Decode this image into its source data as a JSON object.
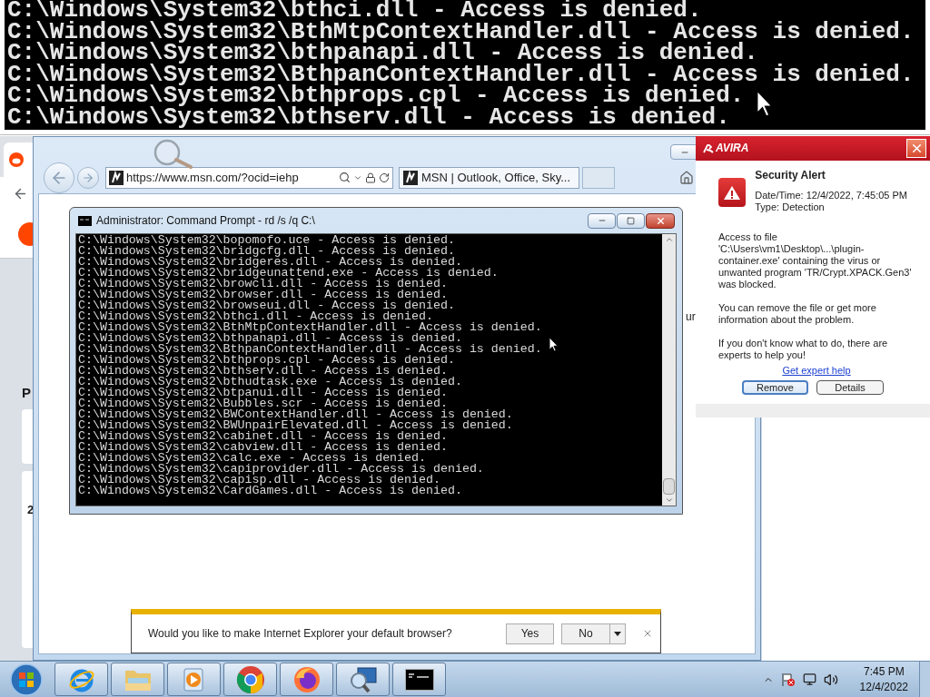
{
  "zoomed_console": {
    "lines": [
      "C:\\Windows\\System32\\bthci.dll - Access is denied.",
      "C:\\Windows\\System32\\BthMtpContextHandler.dll - Access is denied.",
      "C:\\Windows\\System32\\bthpanapi.dll - Access is denied.",
      "C:\\Windows\\System32\\BthpanContextHandler.dll - Access is denied.",
      "C:\\Windows\\System32\\bthprops.cpl - Access is denied.",
      "C:\\Windows\\System32\\bthserv.dll - Access is denied."
    ]
  },
  "background_page": {
    "heading": "P",
    "card_text": "2"
  },
  "ie": {
    "address": "https://www.msn.com/?ocid=iehp",
    "tab_title": "MSN | Outlook, Office, Sky...",
    "page_fragment": "ur",
    "notification": {
      "message": "Would you like to make Internet Explorer your default browser?",
      "buttons": [
        "Yes",
        "No"
      ]
    }
  },
  "cmd": {
    "title": "Administrator: Command Prompt - rd  /s /q C:\\",
    "lines": [
      "C:\\Windows\\System32\\bopomofo.uce - Access is denied.",
      "C:\\Windows\\System32\\bridgcfg.dll - Access is denied.",
      "C:\\Windows\\System32\\bridgeres.dll - Access is denied.",
      "C:\\Windows\\System32\\bridgeunattend.exe - Access is denied.",
      "C:\\Windows\\System32\\browcli.dll - Access is denied.",
      "C:\\Windows\\System32\\browser.dll - Access is denied.",
      "C:\\Windows\\System32\\browseui.dll - Access is denied.",
      "C:\\Windows\\System32\\bthci.dll - Access is denied.",
      "C:\\Windows\\System32\\BthMtpContextHandler.dll - Access is denied.",
      "C:\\Windows\\System32\\bthpanapi.dll - Access is denied.",
      "C:\\Windows\\System32\\BthpanContextHandler.dll - Access is denied.",
      "C:\\Windows\\System32\\bthprops.cpl - Access is denied.",
      "C:\\Windows\\System32\\bthserv.dll - Access is denied.",
      "C:\\Windows\\System32\\bthudtask.exe - Access is denied.",
      "C:\\Windows\\System32\\btpanui.dll - Access is denied.",
      "C:\\Windows\\System32\\Bubbles.scr - Access is denied.",
      "C:\\Windows\\System32\\BWContextHandler.dll - Access is denied.",
      "C:\\Windows\\System32\\BWUnpairElevated.dll - Access is denied.",
      "C:\\Windows\\System32\\cabinet.dll - Access is denied.",
      "C:\\Windows\\System32\\cabview.dll - Access is denied.",
      "C:\\Windows\\System32\\calc.exe - Access is denied.",
      "C:\\Windows\\System32\\capiprovider.dll - Access is denied.",
      "C:\\Windows\\System32\\capisp.dll - Access is denied.",
      "C:\\Windows\\System32\\CardGames.dll - Access is denied."
    ]
  },
  "avira": {
    "logo": "AVIRA",
    "heading": "Security Alert",
    "details": [
      "Date/Time: 12/4/2022, 7:45:05 PM",
      "Type: Detection"
    ],
    "paragraphs": [
      "Access to file 'C:\\Users\\vm1\\Desktop\\...\\plugin-container.exe' containing the virus or unwanted program 'TR/Crypt.XPACK.Gen3' was blocked.",
      "You can remove the file or get more information about the problem.",
      "If you don't know what to do, there are experts to help you!"
    ],
    "link": "Get expert help",
    "buttons": [
      {
        "label": "Remove",
        "focused": true
      },
      {
        "label": "Details",
        "focused": false
      }
    ]
  },
  "taskbar": {
    "apps": [
      {
        "kind": "ie"
      },
      {
        "kind": "folder"
      },
      {
        "kind": "media"
      },
      {
        "kind": "chrome"
      },
      {
        "kind": "firefox"
      },
      {
        "kind": "search"
      },
      {
        "kind": "console"
      }
    ],
    "time": "7:45 PM",
    "date": "12/4/2022"
  }
}
